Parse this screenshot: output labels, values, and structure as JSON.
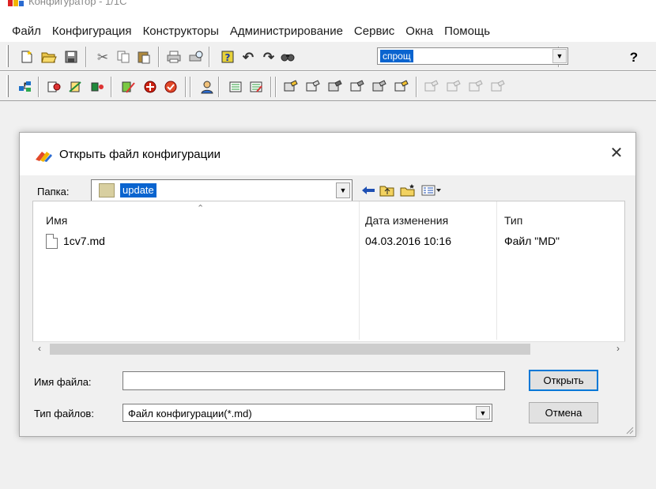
{
  "app": {
    "title": "Конфигуратор - 1/1С"
  },
  "menubar": {
    "items": [
      "Файл",
      "Конфигурация",
      "Конструкторы",
      "Администрирование",
      "Сервис",
      "Окна",
      "Помощь"
    ]
  },
  "toolbar": {
    "search_value": "спрощ",
    "help_glyph": "?"
  },
  "dialog": {
    "title": "Открыть файл конфигурации",
    "close_glyph": "✕",
    "folder_label": "Папка:",
    "folder_value": "update",
    "columns": {
      "name": "Имя",
      "date": "Дата изменения",
      "type": "Тип"
    },
    "files": [
      {
        "name": "1cv7.md",
        "date": "04.03.2016 10:16",
        "type": "Файл \"MD\""
      }
    ],
    "filename_label": "Имя файла:",
    "filename_value": "",
    "filetype_label": "Тип файлов:",
    "filetype_value": "Файл конфигурации(*.md)",
    "open_button": "Открыть",
    "cancel_button": "Отмена"
  },
  "colors": {
    "selection": "#0a64cf",
    "default_button_border": "#0078d7"
  }
}
